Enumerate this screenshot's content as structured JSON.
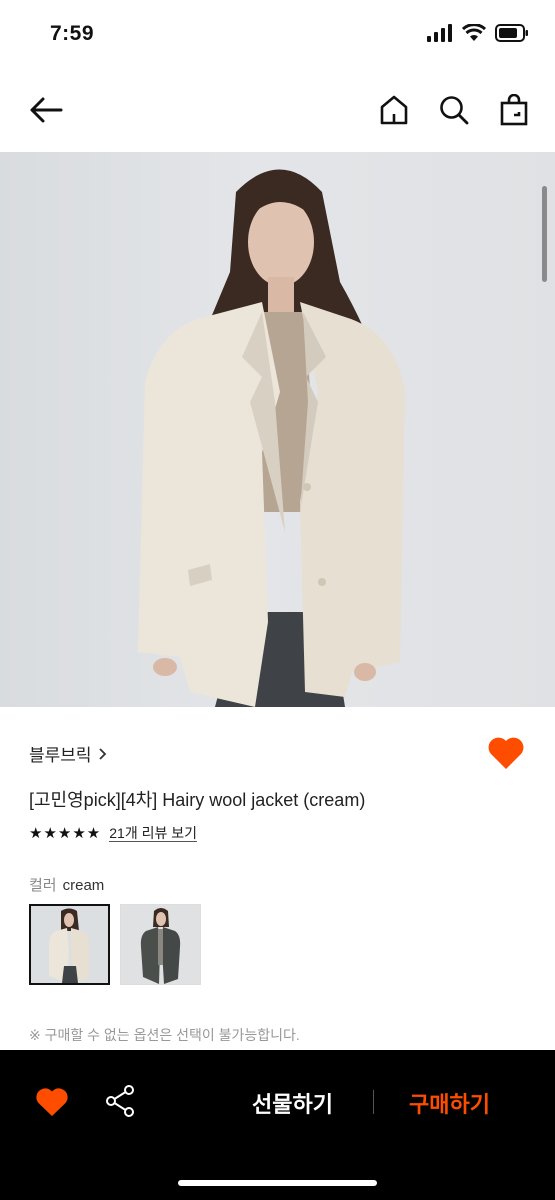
{
  "status": {
    "time": "7:59"
  },
  "nav": {
    "back_icon": "arrow-left-icon",
    "home_icon": "home-icon",
    "search_icon": "search-icon",
    "bag_icon": "shopping-bag-icon"
  },
  "product": {
    "brand": "블루브릭",
    "title": "[고민영pick][4차] Hairy wool jacket (cream)",
    "rating_stars": "★★★★★",
    "review_link": "21개 리뷰 보기",
    "color_key": "컬러",
    "color_value": "cream",
    "options": [
      {
        "name": "cream",
        "selected": true
      },
      {
        "name": "charcoal",
        "selected": false
      }
    ],
    "notice": "※ 구매할 수 없는 옵션은 선택이 불가능합니다."
  },
  "bottom_bar": {
    "gift_label": "선물하기",
    "buy_label": "구매하기"
  },
  "colors": {
    "accent": "#ff4d00",
    "bar_bg": "#000000"
  }
}
